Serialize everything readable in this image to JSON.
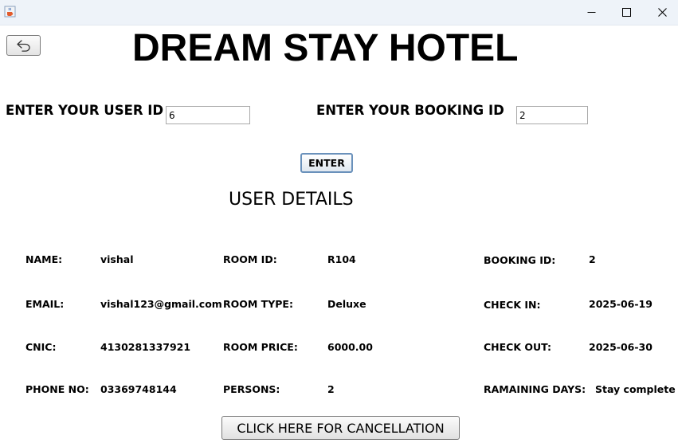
{
  "window": {
    "app_icon": "java-cup-icon",
    "controls": [
      "minimize-icon",
      "maximize-icon",
      "close-icon"
    ]
  },
  "header": {
    "back_icon": "undo-arrow-icon",
    "title": "DREAM STAY HOTEL"
  },
  "form": {
    "user_id_label": "ENTER YOUR USER ID",
    "user_id_value": "6",
    "booking_id_label": "ENTER YOUR BOOKING ID",
    "booking_id_value": "2",
    "enter_label": "ENTER"
  },
  "details": {
    "heading": "USER DETAILS",
    "rows": [
      {
        "c1_label": "NAME:",
        "c1_value": "vishal",
        "c2_label": "ROOM ID:",
        "c2_value": "R104",
        "c3_label": "BOOKING ID:",
        "c3_value": "2"
      },
      {
        "c1_label": "EMAIL:",
        "c1_value": "vishal123@gmail.com",
        "c2_label": "ROOM TYPE:",
        "c2_value": "Deluxe",
        "c3_label": "CHECK IN:",
        "c3_value": "2025-06-19"
      },
      {
        "c1_label": "CNIC:",
        "c1_value": "4130281337921",
        "c2_label": "ROOM PRICE:",
        "c2_value": "6000.00",
        "c3_label": "CHECK OUT:",
        "c3_value": "2025-06-30"
      },
      {
        "c1_label": "PHONE NO:",
        "c1_value": "03369748144",
        "c2_label": "PERSONS:",
        "c2_value": "2",
        "c3_label": "RAMAINING DAYS:",
        "c3_value": "Stay complete"
      }
    ]
  },
  "cancel_label": "CLICK HERE FOR CANCELLATION"
}
